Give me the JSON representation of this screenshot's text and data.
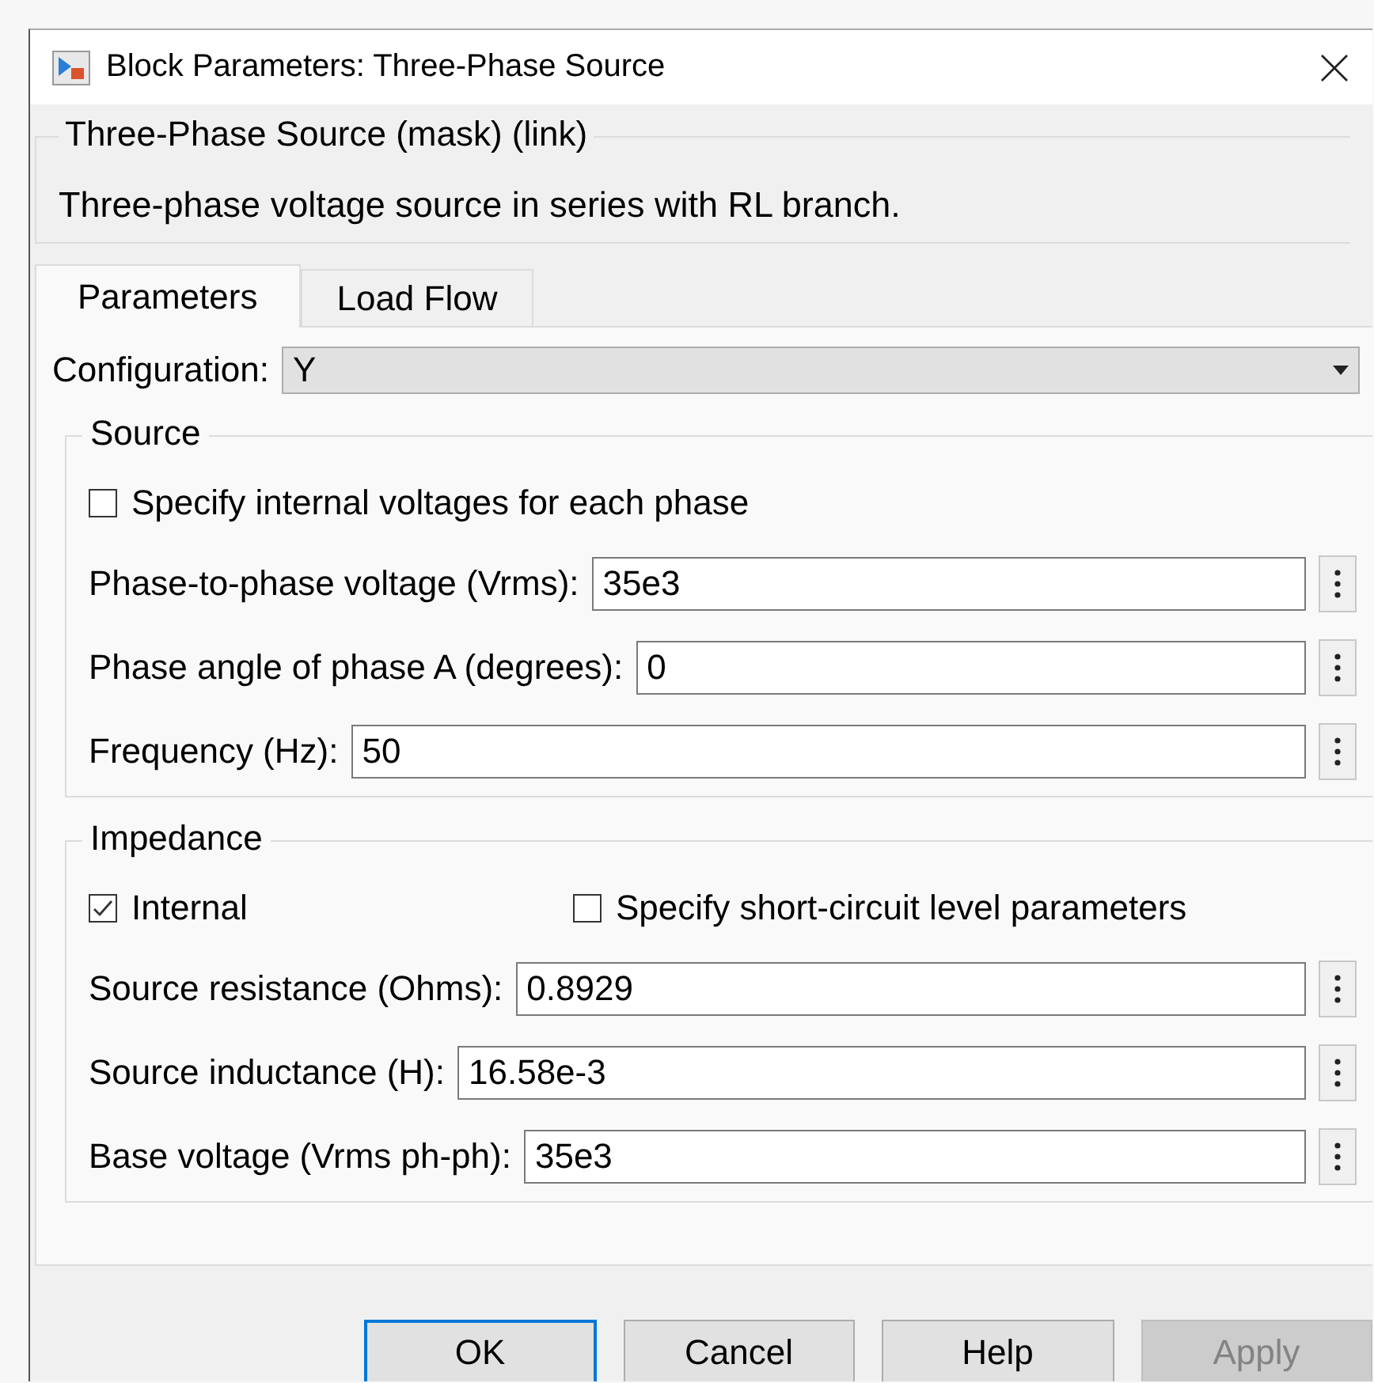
{
  "window": {
    "title": "Block Parameters: Three-Phase Source"
  },
  "mask": {
    "title": "Three-Phase Source (mask) (link)",
    "description": "Three-phase voltage source in series with RL branch."
  },
  "tabs": [
    {
      "label": "Parameters",
      "selected": true
    },
    {
      "label": "Load Flow",
      "selected": false
    }
  ],
  "configuration": {
    "label": "Configuration:",
    "value": "Y"
  },
  "groups": [
    {
      "title": "Source",
      "items": [
        {
          "kind": "checkboxes",
          "options": [
            {
              "label": "Specify internal voltages for each phase",
              "checked": false
            }
          ]
        },
        {
          "kind": "field",
          "label": "Phase-to-phase voltage (Vrms):",
          "value": "35e3"
        },
        {
          "kind": "field",
          "label": "Phase angle of phase A (degrees):",
          "value": "0"
        },
        {
          "kind": "field",
          "label": "Frequency (Hz):",
          "value": "50"
        }
      ]
    },
    {
      "title": "Impedance",
      "items": [
        {
          "kind": "checkboxes",
          "options": [
            {
              "label": "Internal",
              "checked": true
            },
            {
              "label": "Specify short-circuit level parameters",
              "checked": false
            }
          ]
        },
        {
          "kind": "field",
          "label": "Source resistance (Ohms):",
          "value": "0.8929"
        },
        {
          "kind": "field",
          "label": "Source inductance (H):",
          "value": "16.58e-3"
        },
        {
          "kind": "field",
          "label": "Base voltage (Vrms ph-ph):",
          "value": "35e3"
        }
      ]
    }
  ],
  "buttons": [
    {
      "label": "OK",
      "default": true,
      "disabled": false
    },
    {
      "label": "Cancel",
      "default": false,
      "disabled": false
    },
    {
      "label": "Help",
      "default": false,
      "disabled": false
    },
    {
      "label": "Apply",
      "default": false,
      "disabled": true
    }
  ]
}
